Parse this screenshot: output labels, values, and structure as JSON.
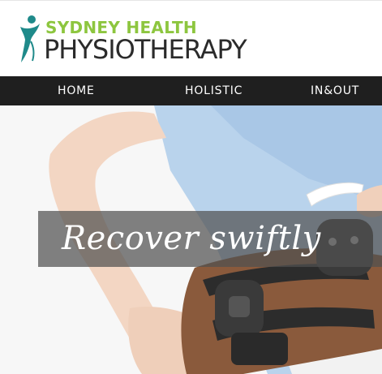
{
  "brand": {
    "name_line1": "SYDNEY HEALTH",
    "name_line2": "PHYSIOTHERAPY",
    "logo_icon": "figure-swoosh-icon",
    "colors": {
      "green": "#8dc63f",
      "teal": "#1f8a8a",
      "dark": "#2b2b2b"
    }
  },
  "nav": {
    "items": [
      {
        "label": "HOME"
      },
      {
        "label": "HOLISTIC"
      },
      {
        "label": "IN&OUT"
      }
    ],
    "colors": {
      "background": "#1f1f1f",
      "text": "#ffffff"
    }
  },
  "hero": {
    "headline": "Recover swiftly",
    "image": "knee-brace-photo"
  }
}
